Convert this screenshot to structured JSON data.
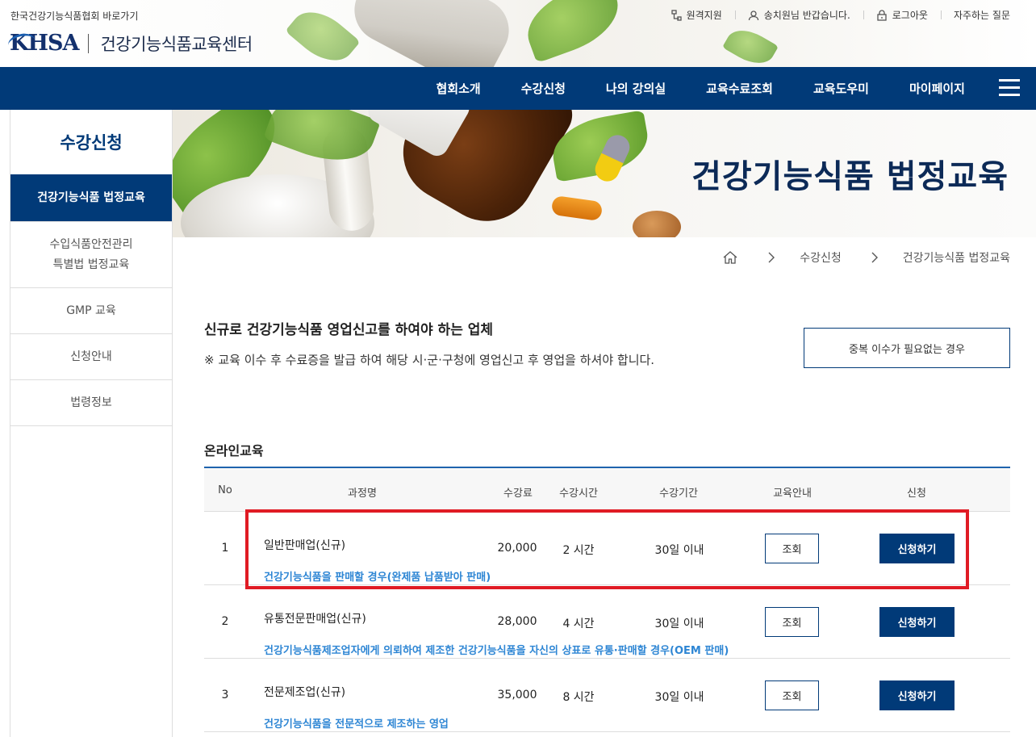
{
  "header": {
    "site_link": "한국건강기능식품협회 바로가기",
    "logo_mark": "KHSA",
    "logo_text": "건강기능식품교육센터",
    "util_nav": [
      {
        "label": "원격지원",
        "icon": "remote-support-icon"
      },
      {
        "label": "송치원님 반갑습니다.",
        "icon": "user-icon"
      },
      {
        "label": "로그아웃",
        "icon": "lock-icon"
      },
      {
        "label": "자주하는 질문",
        "icon": ""
      }
    ]
  },
  "gnb": {
    "items": [
      "협회소개",
      "수강신청",
      "나의 강의실",
      "교육수료조회",
      "교육도우미",
      "마이페이지"
    ],
    "menu_icon": "hamburger-menu-icon"
  },
  "sidebar": {
    "title": "수강신청",
    "items": [
      {
        "label": "건강기능식품 법정교육",
        "active": true
      },
      {
        "label": "수입식품안전관리\n특별법 법정교육",
        "active": false
      },
      {
        "label": "GMP 교육",
        "active": false
      },
      {
        "label": "신청안내",
        "active": false
      },
      {
        "label": "법령정보",
        "active": false
      }
    ]
  },
  "visual": {
    "title": "건강기능식품 법정교육"
  },
  "breadcrumb": {
    "home_icon": "home-icon",
    "items": [
      "수강신청",
      "건강기능식품 법정교육"
    ]
  },
  "intro": {
    "title": "신규로 건강기능식품 영업신고를 하여야 하는 업체",
    "note": "※ 교육 이수 후 수료증을 발급 하여 해당 시·군·구청에 영업신고 후 영업을 하셔야 합니다.",
    "dup_button": "중복 이수가 필요없는 경우"
  },
  "online": {
    "section_title": "온라인교육",
    "headers": [
      "No",
      "과정명",
      "수강료",
      "수강시간",
      "수강기간",
      "교육안내",
      "신청"
    ],
    "rows": [
      {
        "no": "1",
        "name": "일반판매업(신규)",
        "desc": "건강기능식품을 판매할 경우(완제품 납품받아 판매)",
        "fee": "20,000",
        "hours": "2 시간",
        "period": "30일 이내",
        "view": "조회",
        "apply": "신청하기"
      },
      {
        "no": "2",
        "name": "유통전문판매업(신규)",
        "desc": "건강기능식품제조업자에게 의뢰하여 제조한 건강기능식품을 자신의 상표로 유통·판매할 경우(OEM 판매)",
        "fee": "28,000",
        "hours": "4 시간",
        "period": "30일 이내",
        "view": "조회",
        "apply": "신청하기"
      },
      {
        "no": "3",
        "name": "전문제조업(신규)",
        "desc": "건강기능식품을 전문적으로 제조하는 영업",
        "fee": "35,000",
        "hours": "8 시간",
        "period": "30일 이내",
        "view": "조회",
        "apply": "신청하기"
      }
    ]
  },
  "colors": {
    "navy": "#013a78",
    "link_blue": "#2e86d4",
    "highlight_red": "#e01b24"
  }
}
